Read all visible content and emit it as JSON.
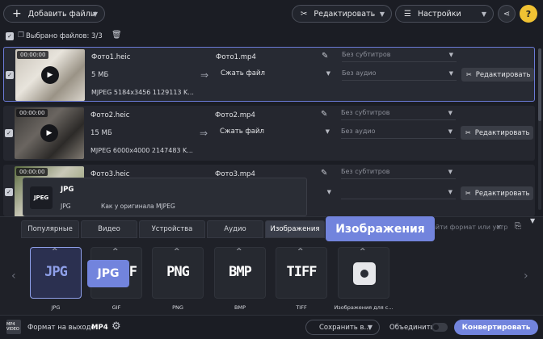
{
  "toolbar": {
    "add_files_label": "Добавить файлы",
    "edit_label": "Редактировать",
    "settings_label": "Настройки",
    "help_label": "?"
  },
  "selection": {
    "text": "Выбрано файлов: 3/3"
  },
  "files": [
    {
      "time": "00:00:00",
      "name": "Фото1.heic",
      "size": "5 МБ",
      "meta": "MJPEG 5184x3456 1129113 K...",
      "output": "Фото1.mp4",
      "compress": "Сжать файл",
      "subtitles": "Без субтитров",
      "audio": "Без аудио",
      "edit": "Редактировать"
    },
    {
      "time": "00:00:00",
      "name": "Фото2.heic",
      "size": "15 МБ",
      "meta": "MJPEG 6000x4000 2147483 K...",
      "output": "Фото2.mp4",
      "compress": "Сжать файл",
      "subtitles": "Без субтитров",
      "audio": "Без аудио",
      "edit": "Редактировать"
    },
    {
      "time": "00:00:00",
      "name": "Фото3.heic",
      "output": "Фото3.mp4",
      "subtitles": "Без субтитров",
      "edit": "Редактировать"
    }
  ],
  "popup": {
    "icon_text": "JPEG",
    "title": "JPG",
    "sub1": "JPG",
    "sub2": "Как у оригинала",
    "sub3": "MJPEG"
  },
  "tabs": [
    "Популярные",
    "Видео",
    "Устройства",
    "Аудио",
    "Изображения"
  ],
  "search_placeholder": "Найти формат или устройство...",
  "tooltip_label": "Изображения",
  "jpg_bubble": "JPG",
  "formats": [
    {
      "big": "JPG",
      "label": "JPG"
    },
    {
      "big": "F",
      "label": "GIF"
    },
    {
      "big": "PNG",
      "label": "PNG"
    },
    {
      "big": "BMP",
      "label": "BMP"
    },
    {
      "big": "TIFF",
      "label": "TIFF"
    },
    {
      "big": "",
      "label": "Изображения для с..."
    }
  ],
  "bottom": {
    "icon_text": "MP4 VIDEO",
    "format_label": "Формат на выходе:",
    "format_value": "MP4",
    "save_label": "Сохранить в...",
    "merge_label": "Объединить:",
    "convert_label": "Конвертировать"
  },
  "colors": {
    "accent": "#7284dd",
    "background": "#1b1d24",
    "help": "#f0c233"
  }
}
